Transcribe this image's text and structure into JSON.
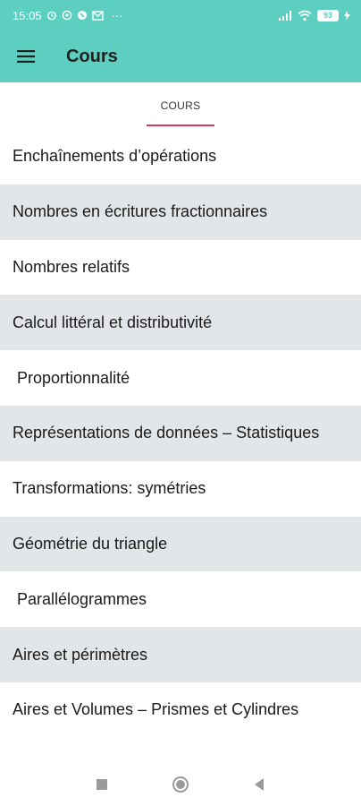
{
  "status_bar": {
    "time": "15:05",
    "battery": "93",
    "overflow": "···"
  },
  "app_bar": {
    "title": "Cours"
  },
  "tabs": [
    {
      "label": "COURS",
      "selected": true
    }
  ],
  "courses": [
    "Enchaînements d’opérations",
    "Nombres en écritures fractionnaires",
    "Nombres relatifs",
    "Calcul littéral et distributivité",
    " Proportionnalité",
    "Représentations de données – Statistiques",
    "Transformations: symétries",
    "Géométrie du triangle",
    " Parallélogrammes",
    "Aires et périmètres",
    "Aires et Volumes – Prismes et Cylindres"
  ],
  "colors": {
    "primary": "#5ccfc1",
    "tab_indicator": "#d23b5a",
    "row_shade": "#e3e6e9"
  },
  "icons": {
    "menu": "hamburger-menu-icon",
    "nav_recents": "square-icon",
    "nav_home": "circle-icon",
    "nav_back": "triangle-back-icon"
  }
}
